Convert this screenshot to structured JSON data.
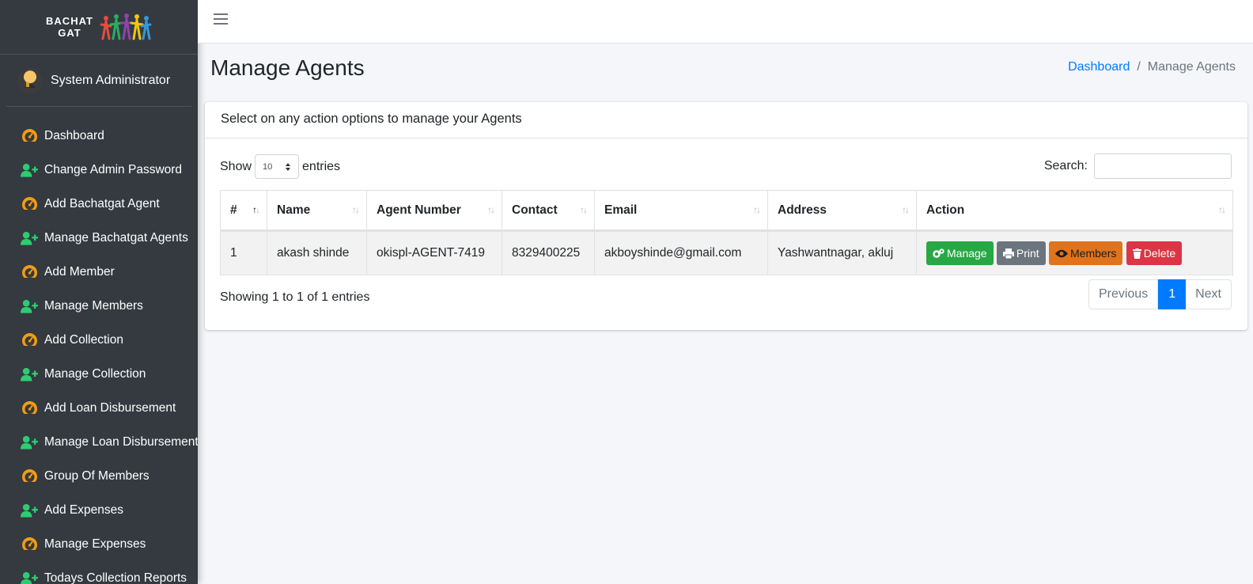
{
  "brand": {
    "line1": "BACHAT",
    "line2": "GAT"
  },
  "user": {
    "name": "System Administrator"
  },
  "sidebar": {
    "items": [
      {
        "label": "Dashboard",
        "icon": "dashboard-icon"
      },
      {
        "label": "Change Admin Password",
        "icon": "user-plus-icon"
      },
      {
        "label": "Add Bachatgat Agent",
        "icon": "dashboard-icon"
      },
      {
        "label": "Manage Bachatgat Agents",
        "icon": "user-plus-icon"
      },
      {
        "label": "Add Member",
        "icon": "dashboard-icon"
      },
      {
        "label": "Manage Members",
        "icon": "user-plus-icon"
      },
      {
        "label": "Add Collection",
        "icon": "dashboard-icon"
      },
      {
        "label": "Manage Collection",
        "icon": "user-plus-icon"
      },
      {
        "label": "Add Loan Disbursement",
        "icon": "dashboard-icon"
      },
      {
        "label": "Manage Loan Disbursement",
        "icon": "user-plus-icon"
      },
      {
        "label": "Group Of Members",
        "icon": "dashboard-icon"
      },
      {
        "label": "Add Expenses",
        "icon": "user-plus-icon"
      },
      {
        "label": "Manage Expenses",
        "icon": "dashboard-icon"
      },
      {
        "label": "Todays Collection Reports",
        "icon": "user-plus-icon"
      }
    ]
  },
  "page": {
    "title": "Manage Agents"
  },
  "breadcrumb": {
    "home": "Dashboard",
    "separator": "/",
    "current": "Manage Agents"
  },
  "card": {
    "header": "Select on any action options to manage your Agents"
  },
  "table_controls": {
    "show_label": "Show",
    "entries_value": "10",
    "entries_label": "entries",
    "search_label": "Search:"
  },
  "table": {
    "columns": [
      "#",
      "Name",
      "Agent Number",
      "Contact",
      "Email",
      "Address",
      "Action"
    ],
    "rows": [
      {
        "num": "1",
        "name": "akash shinde",
        "agent_number": "okispl-AGENT-7419",
        "contact": "8329400225",
        "email": "akboyshinde@gmail.com",
        "address": "Yashwantnagar, akluj"
      }
    ],
    "actions": {
      "manage": "Manage",
      "print": "Print",
      "members": "Members",
      "delete": "Delete"
    }
  },
  "footer": {
    "info": "Showing 1 to 1 of 1 entries",
    "previous": "Previous",
    "current_page": "1",
    "next": "Next"
  },
  "colors": {
    "sidebar_bg": "#343a40",
    "primary": "#007bff",
    "success": "#28a745",
    "secondary": "#6c757d",
    "warning": "#e0731b",
    "danger": "#dc3545",
    "icon_orange": "#f39c12",
    "icon_green": "#2ecc71"
  }
}
